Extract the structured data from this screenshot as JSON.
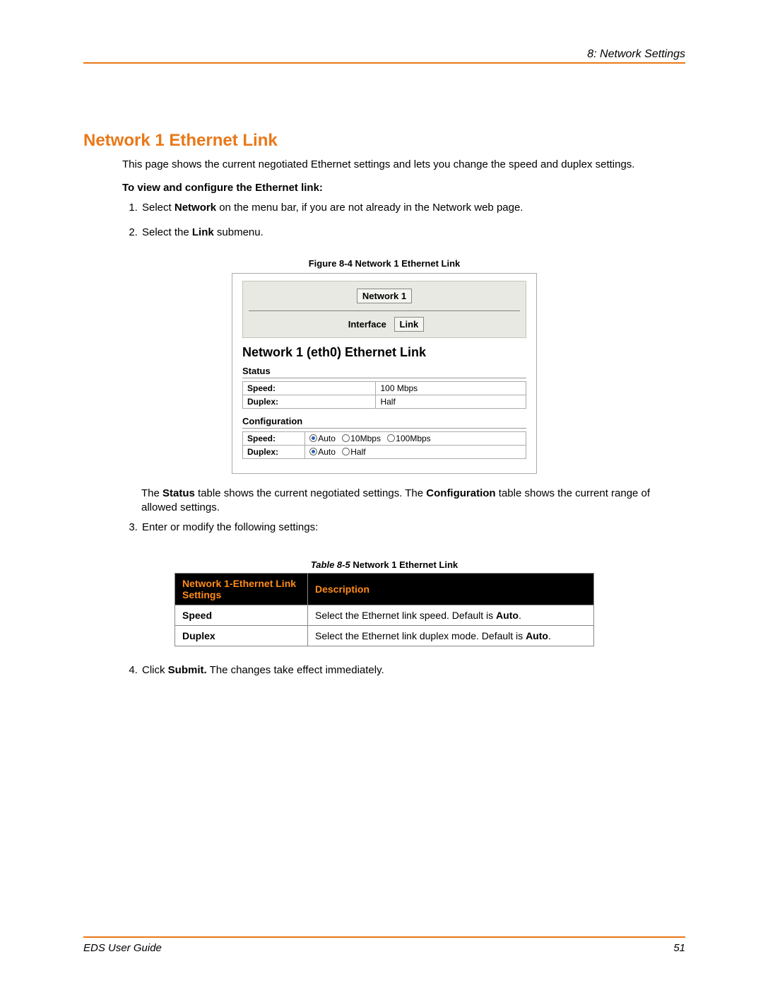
{
  "header": {
    "chapter": "8: Network Settings"
  },
  "title": "Network 1 Ethernet Link",
  "intro": "This page shows the current negotiated Ethernet settings and lets you change the speed and duplex settings.",
  "subheading": "To view and configure the Ethernet link:",
  "steps": {
    "s1_pre": "Select ",
    "s1_b": "Network",
    "s1_post": " on the menu bar, if you are not already in the Network web page.",
    "s2_pre": "Select the  ",
    "s2_b": "Link",
    "s2_post": " submenu.",
    "s3": "Enter or modify the following settings:",
    "s4_pre": "Click ",
    "s4_b": "Submit.",
    "s4_post": " The changes take effect immediately."
  },
  "figure": {
    "caption": "Figure 8-4  Network 1 Ethernet Link",
    "top_button": "Network 1",
    "sub_left": "Interface",
    "sub_right": "Link",
    "heading": "Network 1 (eth0) Ethernet Link",
    "status_label": "Status",
    "status_rows": {
      "speed_k": "Speed:",
      "speed_v": "100 Mbps",
      "duplex_k": "Duplex:",
      "duplex_v": "Half"
    },
    "config_label": "Configuration",
    "config_rows": {
      "speed_k": "Speed:",
      "speed_opts": [
        "Auto",
        "10Mbps",
        "100Mbps"
      ],
      "speed_sel": 0,
      "duplex_k": "Duplex:",
      "duplex_opts": [
        "Auto",
        "Half"
      ],
      "duplex_sel": 0
    }
  },
  "after_figure": {
    "t1": "The ",
    "b1": "Status",
    "t2": " table shows the current negotiated settings. The ",
    "b2": "Configuration",
    "t3": " table shows the current range of allowed settings."
  },
  "table": {
    "caption_i": "Table 8-5",
    "caption_b": "  Network 1 Ethernet Link",
    "h1": "Network 1-Ethernet Link Settings",
    "h2": "Description",
    "rows": [
      {
        "k": "Speed",
        "d_pre": "Select the Ethernet link speed. Default is ",
        "d_b": "Auto",
        "d_post": "."
      },
      {
        "k": "Duplex",
        "d_pre": "Select the Ethernet link duplex mode. Default is ",
        "d_b": "Auto",
        "d_post": "."
      }
    ]
  },
  "footer": {
    "guide": "EDS User Guide",
    "page": "51"
  }
}
